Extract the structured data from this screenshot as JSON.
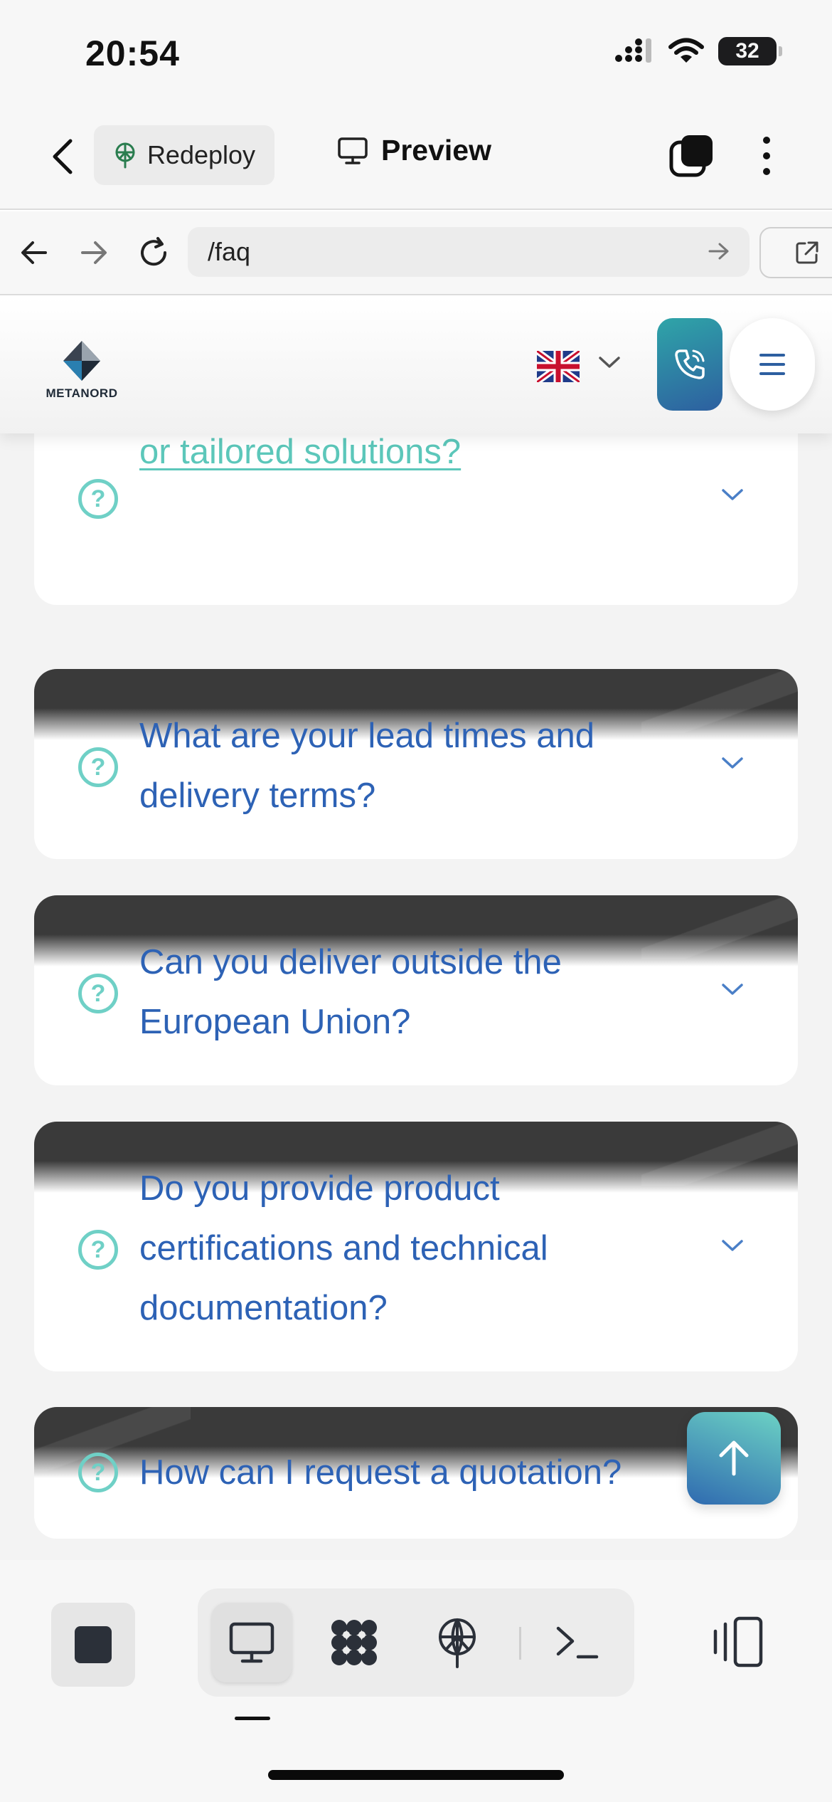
{
  "status_bar": {
    "time": "20:54",
    "battery": "32"
  },
  "toolbar": {
    "redeploy_label": "Redeploy",
    "preview_label": "Preview"
  },
  "url_bar": {
    "path": "/faq"
  },
  "site": {
    "logo_text": "METANORD",
    "language": "English",
    "flag": "uk-flag-icon"
  },
  "faq": {
    "items": [
      {
        "question": "Do you offer custom manufacturing or tailored solutions?",
        "expanded": false,
        "active": true
      },
      {
        "question": "What are your lead times and delivery terms?",
        "expanded": false,
        "active": false
      },
      {
        "question": "Can you deliver outside the European Union?",
        "expanded": false,
        "active": false
      },
      {
        "question": "Do you provide product certifications and technical documentation?",
        "expanded": false,
        "active": false
      },
      {
        "question": "How can I request a quotation?",
        "expanded": false,
        "active": false
      }
    ]
  },
  "colors": {
    "accent_teal": "#5cc7ba",
    "link_blue": "#2d62b5",
    "card_dark": "#3a3a3a"
  },
  "bottom_bar": {
    "modes": [
      "desktop-icon",
      "components-icon",
      "deploy-icon",
      "terminal-icon"
    ],
    "selected_mode": "desktop-icon"
  }
}
